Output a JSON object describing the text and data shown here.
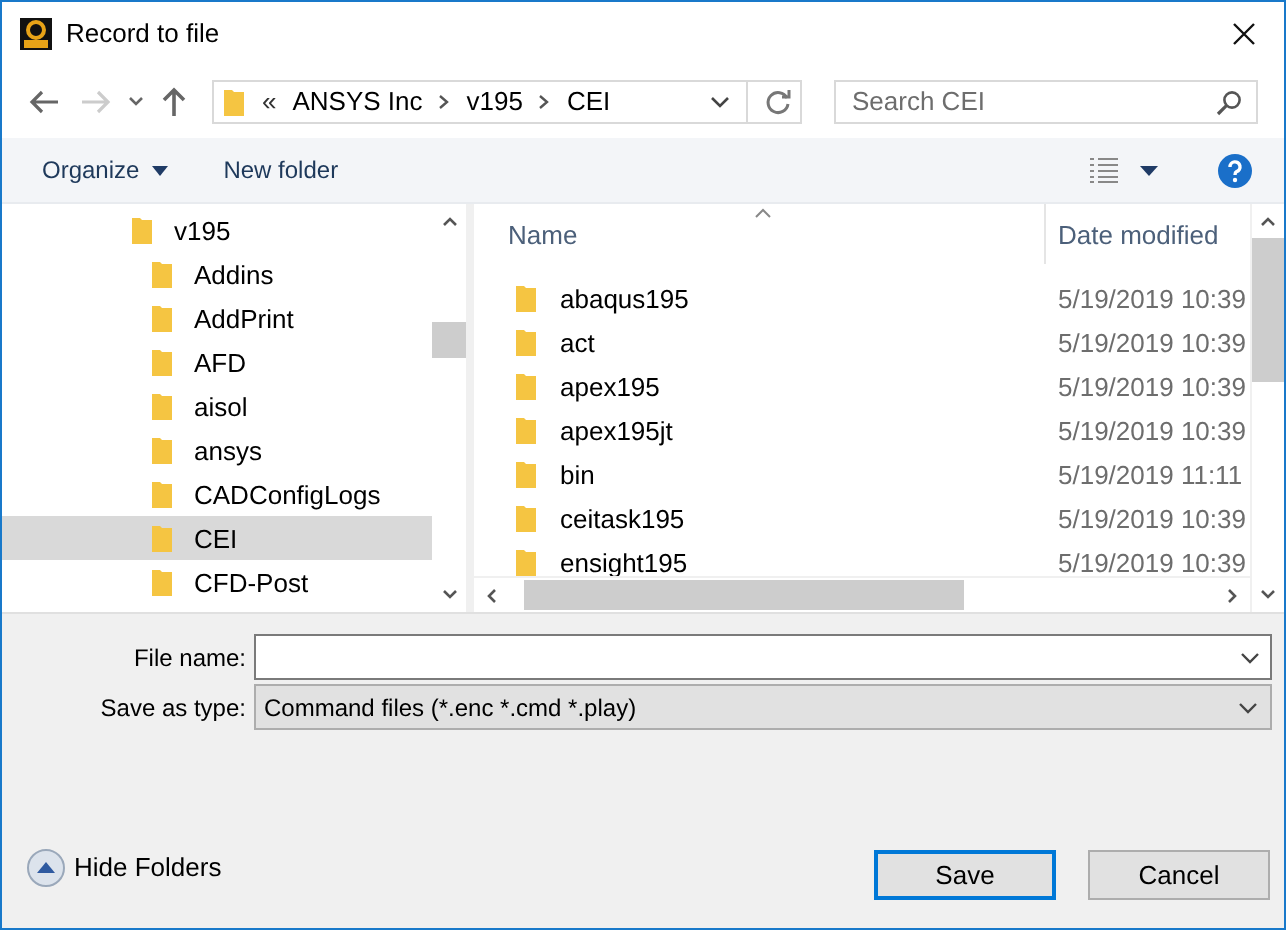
{
  "window": {
    "title": "Record to file"
  },
  "nav": {
    "buttons": [
      {
        "kind": "back",
        "disabled": false
      },
      {
        "kind": "forward",
        "disabled": true
      },
      {
        "kind": "recent",
        "disabled": false
      },
      {
        "kind": "up",
        "disabled": false
      }
    ],
    "overflow_marker": "«",
    "breadcrumb": [
      "ANSYS Inc",
      "v195",
      "CEI"
    ],
    "search": {
      "placeholder": "Search CEI"
    }
  },
  "toolbar": {
    "organize": "Organize",
    "new_folder": "New folder"
  },
  "tree": {
    "items": [
      {
        "label": "v195",
        "selected": false,
        "children": [
          {
            "label": "Addins",
            "selected": false
          },
          {
            "label": "AddPrint",
            "selected": false
          },
          {
            "label": "AFD",
            "selected": false
          },
          {
            "label": "aisol",
            "selected": false
          },
          {
            "label": "ansys",
            "selected": false
          },
          {
            "label": "CADConfigLogs",
            "selected": false
          },
          {
            "label": "CEI",
            "selected": true
          },
          {
            "label": "CFD-Post",
            "selected": false
          }
        ]
      }
    ]
  },
  "files": {
    "columns": [
      "Name",
      "Date modified"
    ],
    "rows": [
      {
        "name": "abaqus195",
        "date": "5/19/2019 10:39"
      },
      {
        "name": "act",
        "date": "5/19/2019 10:39"
      },
      {
        "name": "apex195",
        "date": "5/19/2019 10:39"
      },
      {
        "name": "apex195jt",
        "date": "5/19/2019 10:39"
      },
      {
        "name": "bin",
        "date": "5/19/2019 11:11"
      },
      {
        "name": "ceitask195",
        "date": "5/19/2019 10:39"
      },
      {
        "name": "ensight195",
        "date": "5/19/2019 10:39"
      }
    ]
  },
  "form": {
    "file_name": {
      "label": "File name:"
    },
    "save_type": {
      "label": "Save as type:",
      "value": "Command files (*.enc *.cmd *.play)"
    }
  },
  "hide_folders": "Hide Folders",
  "buttons": [
    {
      "label": "Save",
      "default": true
    },
    {
      "label": "Cancel",
      "default": false
    }
  ]
}
